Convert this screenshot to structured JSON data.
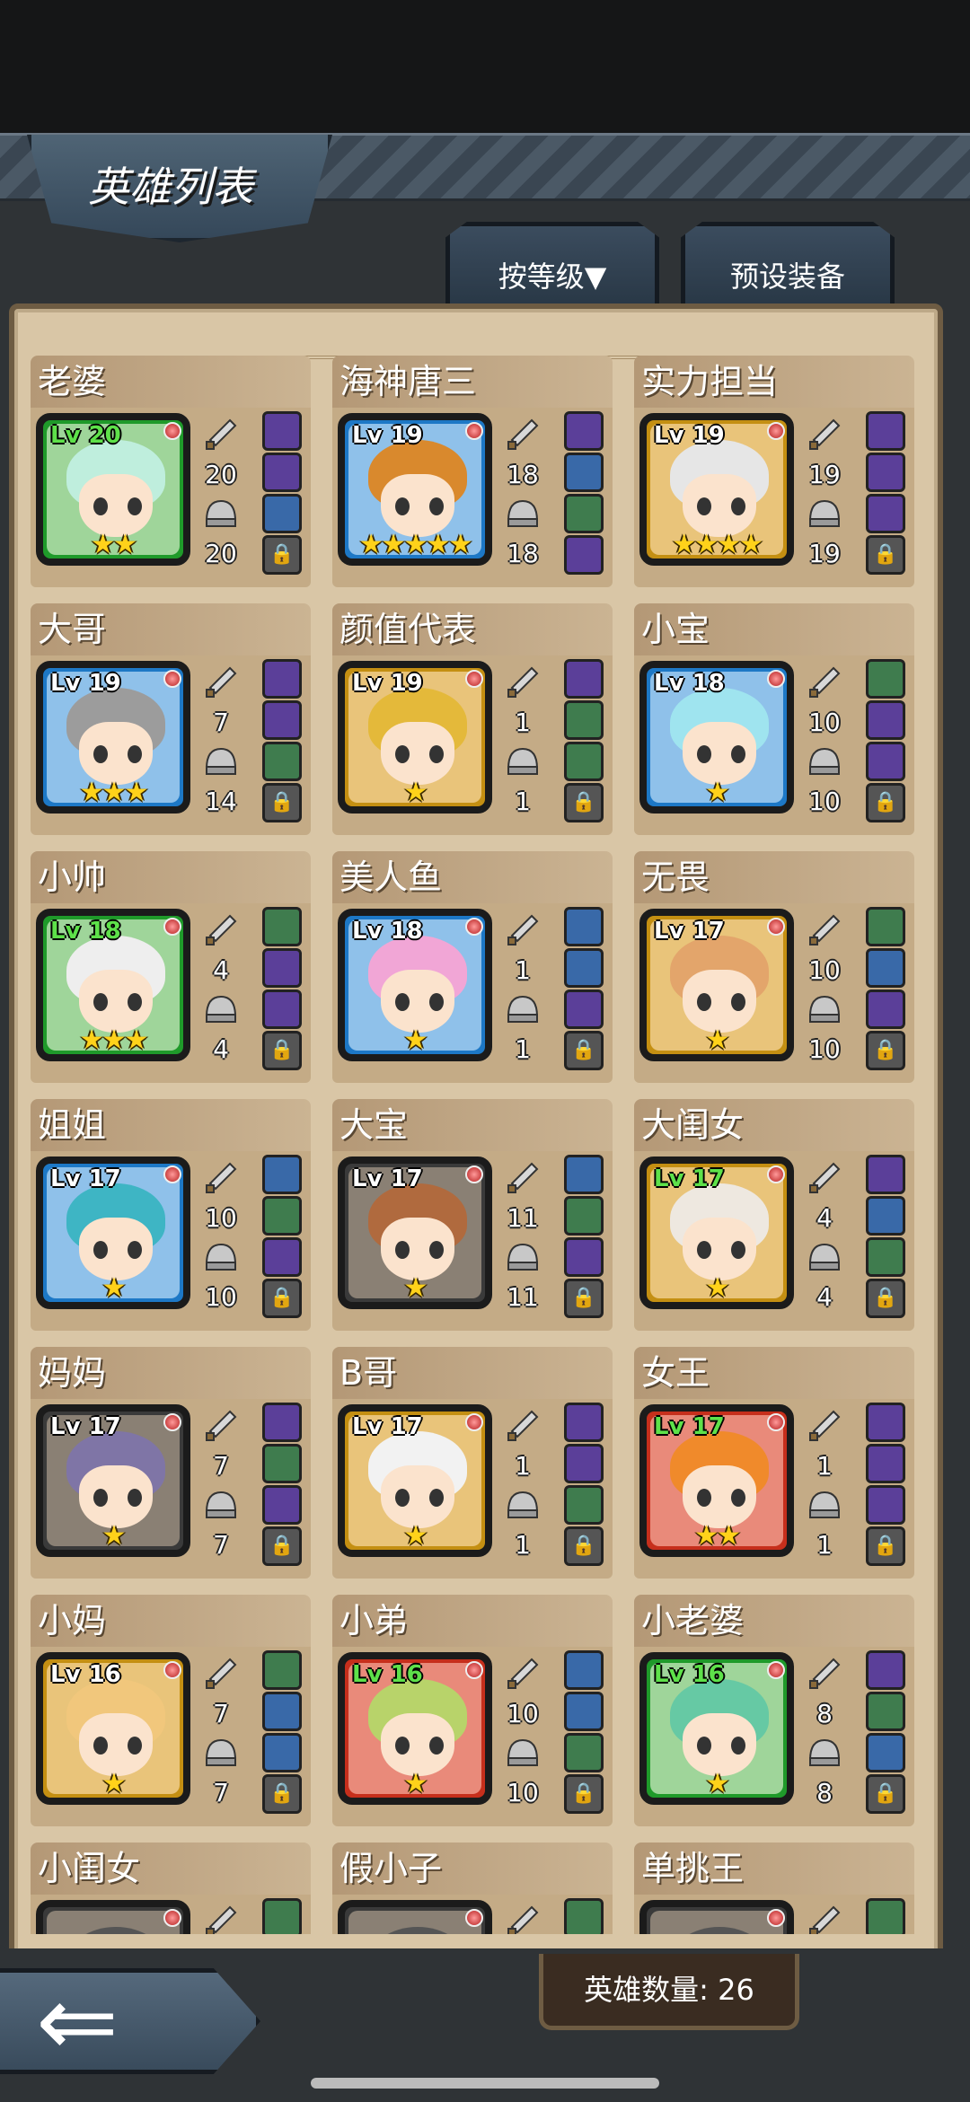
{
  "header": {
    "title": "英雄列表"
  },
  "tabs": {
    "sort_label": "按等级▼",
    "preset_label": "预设装备"
  },
  "footer": {
    "hero_count": "英雄数量: 26",
    "back_icon": "back-arrow-icon"
  },
  "colors": {
    "panel": "#d9c6a6",
    "green_frame": "#1f9a2a",
    "blue_frame": "#1d78c6",
    "gold_frame": "#c48f12",
    "red_frame": "#c62f1c",
    "dark_frame": "#3a3a3a"
  },
  "heroes": [
    {
      "name": "老婆",
      "lv": "Lv 20",
      "frame": "green",
      "stars": "★★",
      "atk": "20",
      "def": "20",
      "eq": [
        "purple",
        "purple",
        "blue",
        "lock"
      ]
    },
    {
      "name": "海神唐三",
      "lv": "Lv 19",
      "frame": "blue",
      "stars": "★★★★★",
      "atk": "18",
      "def": "18",
      "eq": [
        "purple",
        "blue",
        "green",
        "purple"
      ]
    },
    {
      "name": "实力担当",
      "lv": "Lv 19",
      "frame": "gold",
      "stars": "★★★★",
      "atk": "19",
      "def": "19",
      "eq": [
        "purple",
        "purple",
        "purple",
        "lock"
      ]
    },
    {
      "name": "大哥",
      "lv": "Lv 19",
      "frame": "blue",
      "stars": "★★★",
      "atk": "7",
      "def": "14",
      "eq": [
        "purple",
        "purple",
        "green",
        "lock"
      ]
    },
    {
      "name": "颜值代表",
      "lv": "Lv 19",
      "frame": "gold",
      "stars": "★",
      "atk": "1",
      "def": "1",
      "eq": [
        "purple",
        "green",
        "green",
        "lock"
      ]
    },
    {
      "name": "小宝",
      "lv": "Lv 18",
      "frame": "blue",
      "stars": "★",
      "atk": "10",
      "def": "10",
      "eq": [
        "green",
        "purple",
        "purple",
        "lock"
      ]
    },
    {
      "name": "小帅",
      "lv": "Lv 18",
      "frame": "green",
      "stars": "★★★",
      "atk": "4",
      "def": "4",
      "eq": [
        "green",
        "purple",
        "purple",
        "lock"
      ]
    },
    {
      "name": "美人鱼",
      "lv": "Lv 18",
      "frame": "blue",
      "stars": "★",
      "atk": "1",
      "def": "1",
      "eq": [
        "blue",
        "blue",
        "purple",
        "lock"
      ]
    },
    {
      "name": "无畏",
      "lv": "Lv 17",
      "frame": "gold",
      "stars": "★",
      "atk": "10",
      "def": "10",
      "eq": [
        "green",
        "blue",
        "purple",
        "lock"
      ]
    },
    {
      "name": "姐姐",
      "lv": "Lv 17",
      "frame": "blue",
      "stars": "★",
      "atk": "10",
      "def": "10",
      "eq": [
        "blue",
        "green",
        "purple",
        "lock"
      ]
    },
    {
      "name": "大宝",
      "lv": "Lv 17",
      "frame": "dark",
      "stars": "★",
      "atk": "11",
      "def": "11",
      "eq": [
        "blue",
        "green",
        "purple",
        "lock"
      ]
    },
    {
      "name": "大闺女",
      "lv": "Lv 17",
      "frame": "gold",
      "stars": "★",
      "atk": "4",
      "def": "4",
      "eq": [
        "purple",
        "blue",
        "green",
        "lock"
      ]
    },
    {
      "name": "妈妈",
      "lv": "Lv 17",
      "frame": "dark",
      "stars": "★",
      "atk": "7",
      "def": "7",
      "eq": [
        "purple",
        "green",
        "purple",
        "lock"
      ]
    },
    {
      "name": "B哥",
      "lv": "Lv 17",
      "frame": "gold",
      "stars": "★",
      "atk": "1",
      "def": "1",
      "eq": [
        "purple",
        "purple",
        "green",
        "lock"
      ]
    },
    {
      "name": "女王",
      "lv": "Lv 17",
      "frame": "red",
      "stars": "★★",
      "atk": "1",
      "def": "1",
      "eq": [
        "purple",
        "purple",
        "purple",
        "lock"
      ]
    },
    {
      "name": "小妈",
      "lv": "Lv 16",
      "frame": "gold",
      "stars": "★",
      "atk": "7",
      "def": "7",
      "eq": [
        "green",
        "blue",
        "blue",
        "lock"
      ]
    },
    {
      "name": "小弟",
      "lv": "Lv 16",
      "frame": "red",
      "stars": "★",
      "atk": "10",
      "def": "10",
      "eq": [
        "blue",
        "blue",
        "green",
        "lock"
      ]
    },
    {
      "name": "小老婆",
      "lv": "Lv 16",
      "frame": "green",
      "stars": "★",
      "atk": "8",
      "def": "8",
      "eq": [
        "purple",
        "green",
        "blue",
        "lock"
      ]
    },
    {
      "name": "小闺女",
      "lv": "",
      "frame": "dark",
      "stars": "",
      "atk": "",
      "def": "",
      "eq": [
        "green",
        "green",
        "green",
        "lock"
      ]
    },
    {
      "name": "假小子",
      "lv": "",
      "frame": "dark",
      "stars": "",
      "atk": "",
      "def": "",
      "eq": [
        "green",
        "green",
        "green",
        "lock"
      ]
    },
    {
      "name": "单挑王",
      "lv": "",
      "frame": "dark",
      "stars": "",
      "atk": "",
      "def": "",
      "eq": [
        "green",
        "green",
        "green",
        "lock"
      ]
    }
  ]
}
